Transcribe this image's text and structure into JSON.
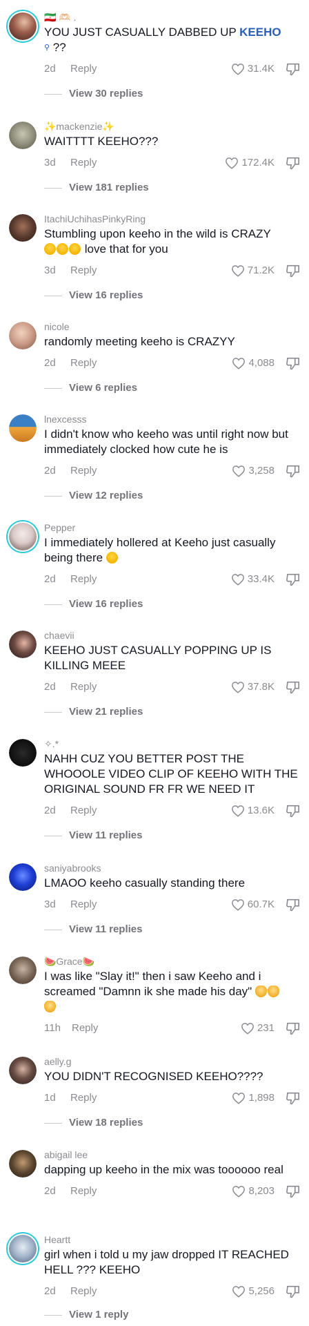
{
  "reply_label": "Reply",
  "comments": [
    {
      "username": "🇮🇷 🫶🏻 .",
      "text": "YOU JUST CASUALLY DABBED UP ",
      "mention": "KEEHO",
      "text_after": "?? ",
      "time": "2d",
      "likes": "31.4K",
      "replies": "View 30 replies",
      "avatar_color": "#9a5b4a"
    },
    {
      "username": "✨mackenzie✨",
      "text": "WAITTTT KEEHO???",
      "time": "3d",
      "likes": "172.4K",
      "replies": "View 181 replies",
      "avatar_color": "#8c8a78"
    },
    {
      "username": "ItachiUchihasPinkyRing",
      "text": "Stumbling upon keeho in the wild is CRAZY",
      "text2": "love that for you",
      "time": "3d",
      "likes": "71.2K",
      "replies": "View 16 replies",
      "avatar_color": "#5a3b2e"
    },
    {
      "username": "nicole",
      "text": "randomly meeting keeho is CRAZYY",
      "time": "2d",
      "likes": "4,088",
      "replies": "View 6 replies",
      "avatar_color": "#c99a86"
    },
    {
      "username": "lnexcesss",
      "text": "I didn't know who keeho was until right now but immediately clocked how cute he is",
      "time": "2d",
      "likes": "3,258",
      "replies": "View 12 replies",
      "avatar_color": "#3b7fc4"
    },
    {
      "username": "Pepper",
      "text": "I immediately hollered at Keeho just casually being there",
      "time": "2d",
      "likes": "33.4K",
      "replies": "View 16 replies",
      "avatar_color": "#d9c9c6"
    },
    {
      "username": "chaevii",
      "text": "KEEHO JUST CASUALLY POPPING UP IS KILLING MEEE",
      "time": "2d",
      "likes": "37.8K",
      "replies": "View 21 replies",
      "avatar_color": "#3a2a2a"
    },
    {
      "username": "✧.*",
      "text": "NAHH CUZ YOU BETTER POST THE WHOOOLE VIDEO CLIP OF KEEHO WITH THE ORIGINAL SOUND FR FR WE NEED IT",
      "time": "2d",
      "likes": "13.6K",
      "replies": "View 11 replies",
      "avatar_color": "#111111"
    },
    {
      "username": "saniyabrooks",
      "text": "LMAOO keeho casually standing there",
      "time": "3d",
      "likes": "60.7K",
      "replies": "View 11 replies",
      "avatar_color": "#1f3fd6"
    },
    {
      "username": "🍉Grace🍉",
      "text": "I was like \"Slay it!\" then i saw Keeho and i screamed \"Damnn ik she made his day\"",
      "time": "11h",
      "likes": "231",
      "replies": "",
      "avatar_color": "#7a6656"
    },
    {
      "username": "aelly.g",
      "text": "YOU DIDN'T RECOGNISED KEEHO????",
      "time": "1d",
      "likes": "1,898",
      "replies": "View 18 replies",
      "avatar_color": "#3b2d2a"
    },
    {
      "username": "abigail lee",
      "text": "dapping up keeho in the mix was toooooo real",
      "time": "2d",
      "likes": "8,203",
      "replies": "",
      "avatar_color": "#5c4630"
    },
    {
      "username": "Heartt",
      "text": "girl when i told u my jaw dropped IT REACHED HELL ??? KEEHO",
      "time": "2d",
      "likes": "5,256",
      "replies": "View 1 reply",
      "avatar_color": "#9fb0c6"
    }
  ],
  "colors": {
    "meta": "#8a8b91",
    "mention": "#2b5db9",
    "ring": "#2ec9d8"
  }
}
